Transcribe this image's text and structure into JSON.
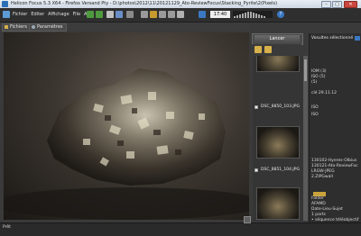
{
  "window": {
    "title": "Helicon Focus 5.3 X64 - Firefox Versand Pty - D:\\photos\\2012\\11\\20121129_Ato-ReviewFocus\\Stacking_Pyrite\\2(Pixels)",
    "min": "–",
    "max": "□",
    "close": "✕"
  },
  "menu": [
    "Fichier",
    "Editer",
    "Affichage",
    "File",
    "Aide"
  ],
  "toolbar": {
    "zoom": "17:40"
  },
  "tabs": [
    {
      "label": "Fichiers"
    },
    {
      "label": "Paramètres"
    }
  ],
  "launch_button": "Lancer",
  "thumbnails": [
    {
      "filename": "DSC_8850_103.JPG"
    },
    {
      "filename": "DSC_8851_104.JPG"
    }
  ],
  "properties": {
    "header": "Vosultes sélectionné",
    "lines": [
      "IOM (3)",
      "ISO (5)",
      "(5)",
      "clé 29.11.12",
      "ISO",
      "ISO",
      "130102-Hyeres-Olbius",
      "130121-Ato-ReviewFoc",
      "LRGW-JPEG",
      "2.ZIPGwall",
      "Folder",
      "AFAMD",
      "Date-Lieu-Sujet",
      "1 parts",
      "• séquence téléobjectif"
    ]
  },
  "status": {
    "text": "Prêt"
  },
  "colors": {
    "accent": "#3b78c2",
    "panel": "#353535",
    "background": "#2b2b2b"
  }
}
